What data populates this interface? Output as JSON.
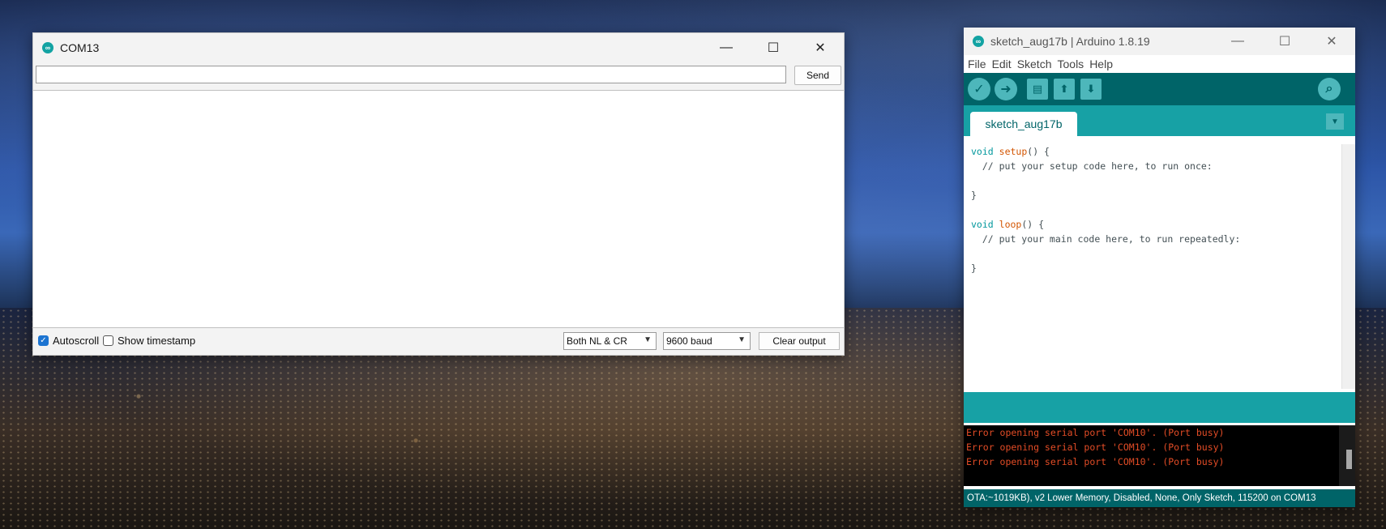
{
  "serial_monitor": {
    "title": "COM13",
    "send_label": "Send",
    "input_value": "",
    "autoscroll_label": "Autoscroll",
    "autoscroll_checked": true,
    "timestamp_label": "Show timestamp",
    "timestamp_checked": false,
    "line_ending": "Both NL & CR",
    "baud": "9600 baud",
    "clear_label": "Clear output"
  },
  "ide": {
    "title": "sketch_aug17b | Arduino 1.8.19",
    "menu": [
      "File",
      "Edit",
      "Sketch",
      "Tools",
      "Help"
    ],
    "tab": "sketch_aug17b",
    "code": [
      [
        "void",
        " ",
        "setup",
        "() {"
      ],
      [
        "",
        "",
        "",
        "  // put your setup code here, to run once:"
      ],
      [
        "",
        "",
        "",
        ""
      ],
      [
        "",
        "",
        "",
        "}"
      ],
      [
        "",
        "",
        "",
        ""
      ],
      [
        "void",
        " ",
        "loop",
        "() {"
      ],
      [
        "",
        "",
        "",
        "  // put your main code here, to run repeatedly:"
      ],
      [
        "",
        "",
        "",
        ""
      ],
      [
        "",
        "",
        "",
        "}"
      ]
    ],
    "console": [
      "Error opening serial port 'COM10'. (Port busy)",
      "Error opening serial port 'COM10'. (Port busy)",
      "Error opening serial port 'COM10'. (Port busy)"
    ],
    "status": "OTA:~1019KB), v2 Lower Memory, Disabled, None, Only Sketch, 115200 on COM13"
  },
  "icons": {
    "verify": "✓",
    "upload": "➜",
    "new": "▤",
    "open": "⬆",
    "save": "⬇",
    "monitor": "⌕",
    "minimize": "—",
    "maximize": "☐",
    "close": "✕"
  }
}
